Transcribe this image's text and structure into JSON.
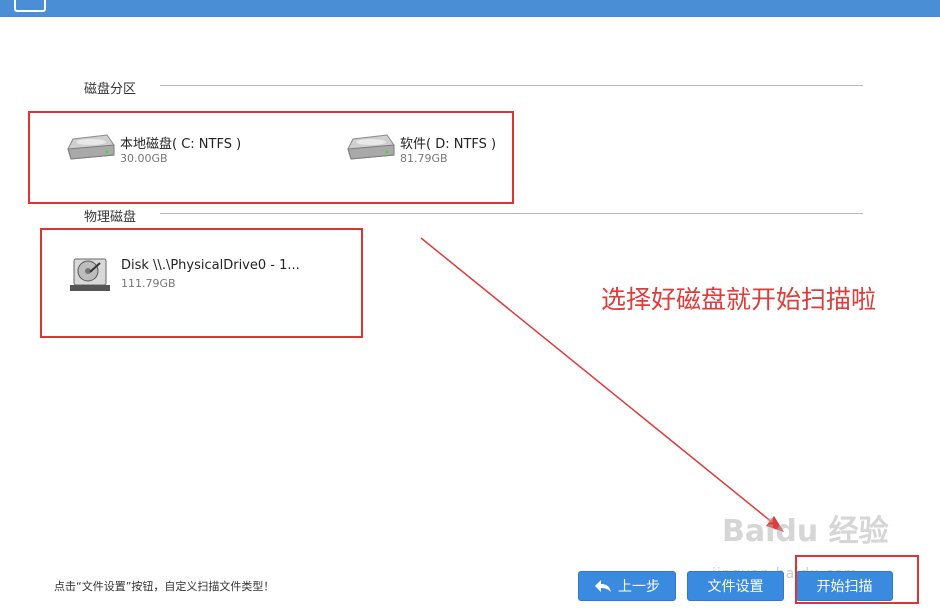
{
  "sections": {
    "partitions_title": "磁盘分区",
    "physical_title": "物理磁盘"
  },
  "partitions": [
    {
      "name": "本地磁盘( C: NTFS )",
      "size": "30.00GB",
      "icon": "hard-drive-icon"
    },
    {
      "name": "软件( D: NTFS )",
      "size": "81.79GB",
      "icon": "hard-drive-icon"
    }
  ],
  "physical_disks": [
    {
      "name": "Disk \\\\.\\PhysicalDrive0 - 1...",
      "size": "111.79GB",
      "icon": "physical-disk-icon"
    }
  ],
  "annotation": "选择好磁盘就开始扫描啦",
  "footer": {
    "hint": "点击“文件设置”按钮，自定义扫描文件类型！",
    "back_label": "上一步",
    "settings_label": "文件设置",
    "start_label": "开始扫描"
  },
  "watermark": {
    "logo": "Baidu 经验",
    "url": "jingyan.baidu.com"
  },
  "colors": {
    "titlebar": "#4a8fd6",
    "button": "#3a8be0",
    "highlight": "#e03333"
  }
}
